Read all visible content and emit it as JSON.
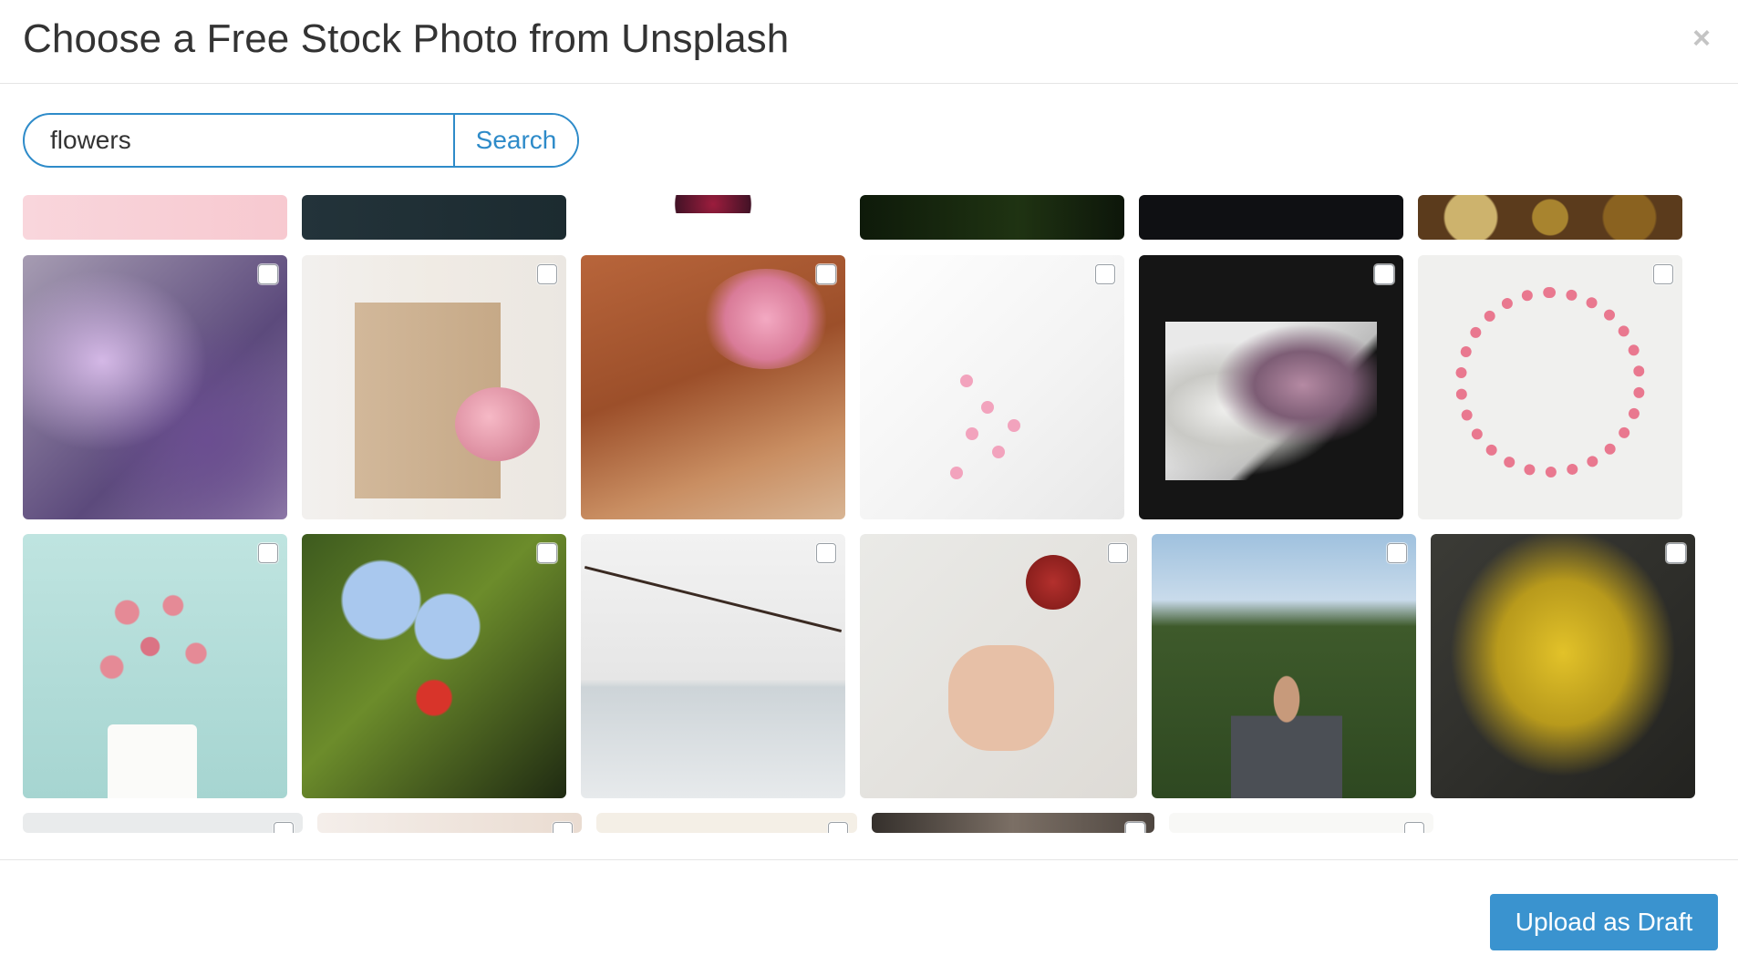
{
  "modal": {
    "title": "Choose a Free Stock Photo from Unsplash",
    "close_icon": "×"
  },
  "search": {
    "value": "flowers",
    "button_label": "Search"
  },
  "gallery": {
    "rows_visible": 4,
    "checkbox_state": "unchecked"
  },
  "footer": {
    "upload_label": "Upload as Draft"
  },
  "colors": {
    "accent": "#2e8bc9",
    "button_bg": "#3a93cf",
    "divider": "#e5e5e5"
  }
}
